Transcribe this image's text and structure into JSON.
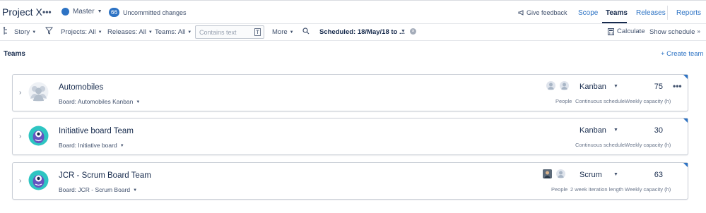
{
  "header": {
    "project_title": "Project X",
    "more_icon": "ellipsis-icon",
    "scenario": {
      "label": "Master",
      "color": "#2d73c4"
    },
    "uncommitted": {
      "count": "66",
      "label": "Uncommitted changes"
    },
    "feedback_label": "Give feedback",
    "tabs": [
      {
        "label": "Scope",
        "active": false
      },
      {
        "label": "Teams",
        "active": true
      },
      {
        "label": "Releases",
        "active": false
      },
      {
        "label": "Reports",
        "active": false
      }
    ]
  },
  "filters": {
    "story_label": "Story",
    "projects_label": "Projects: All",
    "releases_label": "Releases: All",
    "teams_label": "Teams: All",
    "search_placeholder": "Contains text",
    "more_label": "More",
    "scheduled_label": "Scheduled: 18/May/18 to ...",
    "calculate_label": "Calculate",
    "show_schedule_label": "Show schedule"
  },
  "section": {
    "title": "Teams",
    "create_label": "+ Create team"
  },
  "teams": [
    {
      "name": "Automobiles",
      "board": "Board: Automobiles Kanban",
      "method": "Kanban",
      "capacity": "75",
      "people_label": "People",
      "schedule_label": "Continuous schedule",
      "capacity_label": "Weekly capacity (h)",
      "avatar_icon": "generic-team-icon"
    },
    {
      "name": "Initiative board Team",
      "board": "Board: Initiative board",
      "method": "Kanban",
      "capacity": "30",
      "people_label": "",
      "schedule_label": "Continuous schedule",
      "capacity_label": "Weekly capacity (h)",
      "avatar_icon": "monster-avatar-icon"
    },
    {
      "name": "JCR - Scrum Board Team",
      "board": "Board: JCR - Scrum Board",
      "method": "Scrum",
      "capacity": "63",
      "people_label": "People",
      "schedule_label": "2 week iteration length",
      "capacity_label": "Weekly capacity (h)",
      "avatar_icon": "monster-avatar-icon"
    }
  ],
  "colors": {
    "accent": "#2d73c4",
    "text": "#172b4d",
    "muted": "#6b778c"
  }
}
